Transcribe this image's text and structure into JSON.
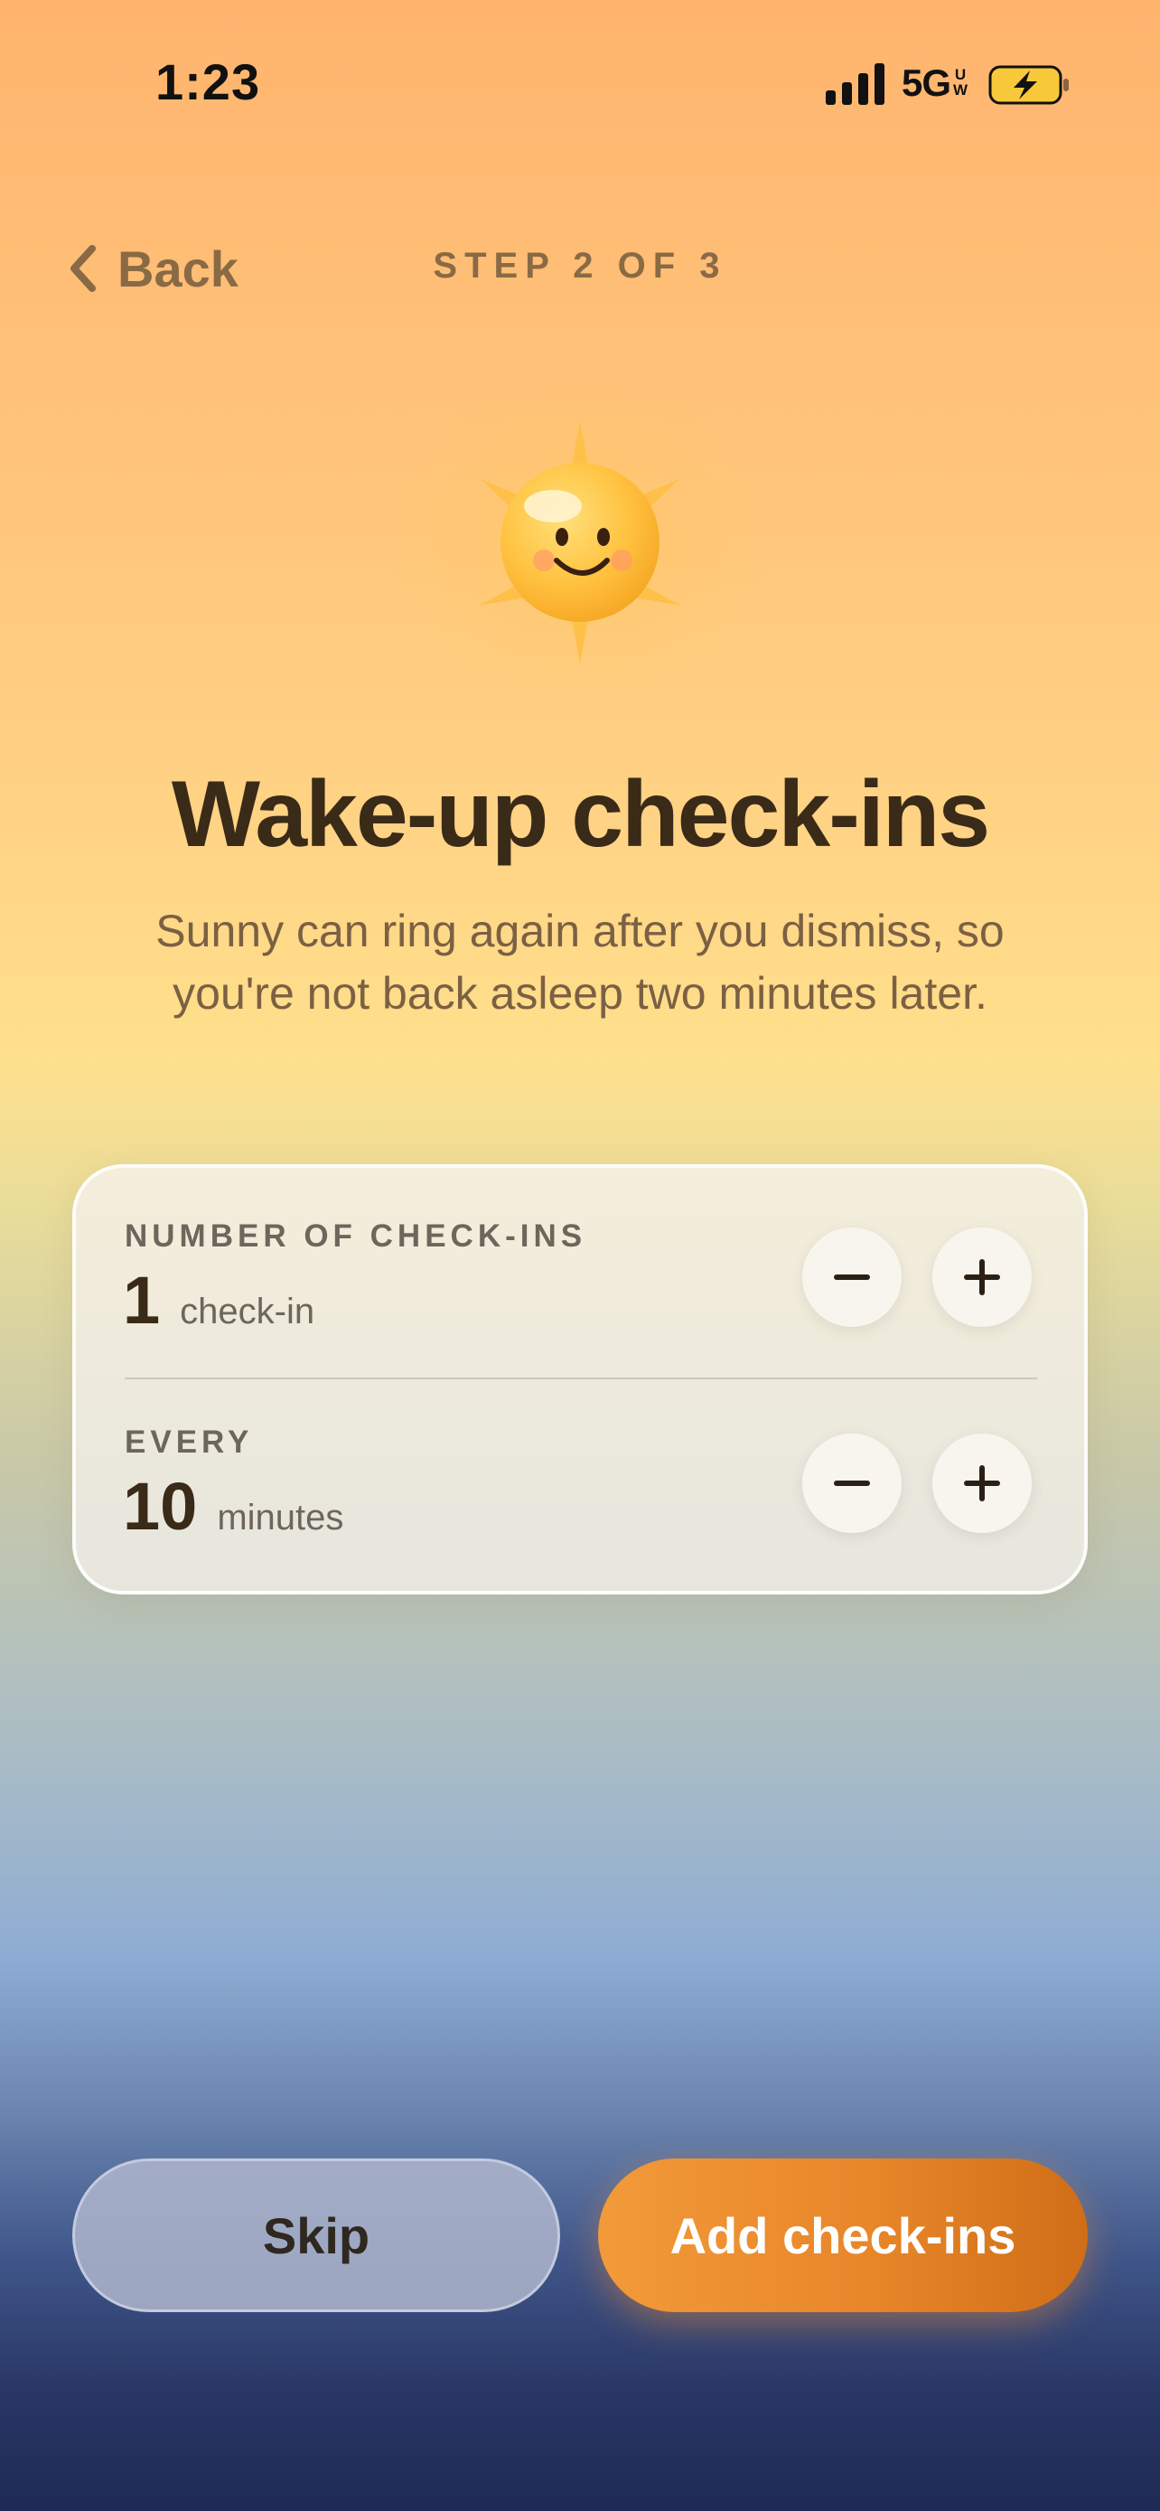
{
  "status_bar": {
    "time": "1:23",
    "network": "5G",
    "network_suffix_top": "U",
    "network_suffix_bottom": "W",
    "icons": [
      "signal-icon",
      "battery-charging-icon"
    ]
  },
  "nav": {
    "back_label": "Back",
    "step": "STEP 2 OF 3"
  },
  "illustration": "sun-mascot-icon",
  "heading": {
    "title": "Wake-up check-ins",
    "subtitle": "Sunny can ring again after you dismiss, so you're not back asleep two minutes later."
  },
  "settings": [
    {
      "label": "NUMBER OF CHECK-INS",
      "value": "1",
      "unit": "check-in"
    },
    {
      "label": "EVERY",
      "value": "10",
      "unit": "minutes"
    }
  ],
  "actions": {
    "skip_label": "Skip",
    "add_label": "Add check-ins"
  },
  "colors": {
    "accent": "#e8862a",
    "text_dark": "#3a2a18",
    "text_brown": "#8a6a45"
  }
}
